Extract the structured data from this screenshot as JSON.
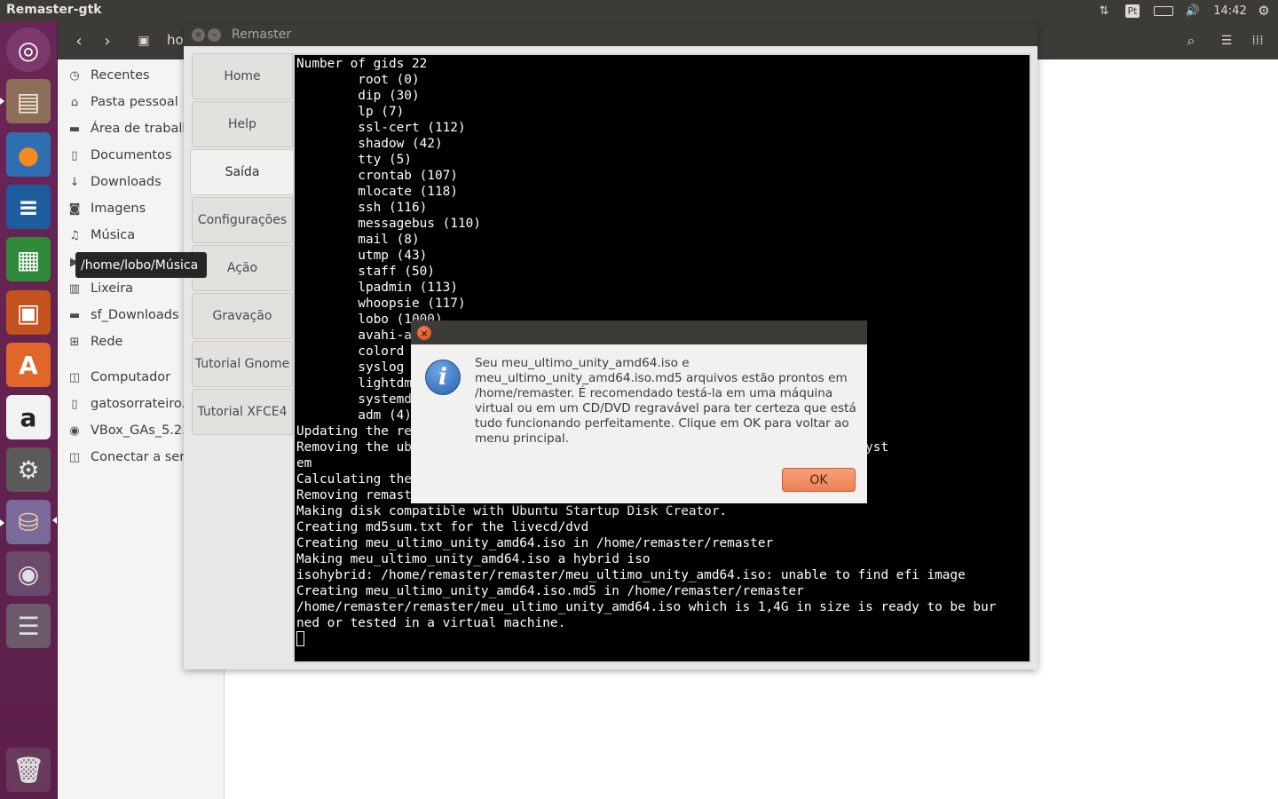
{
  "top_panel": {
    "app_title": "Remaster-gtk",
    "keyboard_layout": "Pt",
    "clock": "14:42"
  },
  "launcher": {
    "items": [
      {
        "name": "ubuntu-dash-icon",
        "glyph": "◎",
        "bg": "#7c3a6c",
        "fg": "#ffffff"
      },
      {
        "name": "files-icon",
        "glyph": "▤",
        "bg": "#8d6e59",
        "fg": "#f2e8dc"
      },
      {
        "name": "firefox-icon",
        "glyph": "●",
        "bg": "#2f6fb1",
        "fg": "#f58a1f"
      },
      {
        "name": "writer-icon",
        "glyph": "≡",
        "bg": "#1f5c9e",
        "fg": "#ffffff"
      },
      {
        "name": "calc-icon",
        "glyph": "▦",
        "bg": "#2f8a3a",
        "fg": "#ffffff"
      },
      {
        "name": "impress-icon",
        "glyph": "▣",
        "bg": "#c4521f",
        "fg": "#ffffff"
      },
      {
        "name": "software-center-icon",
        "glyph": "A",
        "bg": "#e0662a",
        "fg": "#ffffff"
      },
      {
        "name": "amazon-icon",
        "glyph": "a",
        "bg": "#f2f2f2",
        "fg": "#222222"
      },
      {
        "name": "system-settings-icon",
        "glyph": "⚙",
        "bg": "#5a5a5a",
        "fg": "#e8e8e8"
      },
      {
        "name": "remaster-icon",
        "glyph": "⛁",
        "bg": "#7a6a9a",
        "fg": "#f0d0a0"
      },
      {
        "name": "dvd-icon",
        "glyph": "◉",
        "bg": "#6a4a6a",
        "fg": "#e0e0e0"
      },
      {
        "name": "drives-icon",
        "glyph": "☰",
        "bg": "#6a5a6a",
        "fg": "#dcdcdc"
      },
      {
        "name": "trash-icon",
        "glyph": "🗑",
        "bg": "#6a3a5c",
        "fg": "#dcdcdc"
      }
    ]
  },
  "nautilus": {
    "path_fragment": "ho",
    "places": [
      {
        "name": "place-recentes",
        "icon": "clock-icon",
        "glyph": "◷",
        "label": "Recentes"
      },
      {
        "name": "place-pasta-pessoal",
        "icon": "home-icon",
        "glyph": "⌂",
        "label": "Pasta pessoal"
      },
      {
        "name": "place-area-de-trabalho",
        "icon": "desktop-folder-icon",
        "glyph": "▬",
        "label": "Área de trabalh"
      },
      {
        "name": "place-documentos",
        "icon": "document-icon",
        "glyph": "▯",
        "label": "Documentos"
      },
      {
        "name": "place-downloads",
        "icon": "download-icon",
        "glyph": "↓",
        "label": "Downloads"
      },
      {
        "name": "place-imagens",
        "icon": "camera-icon",
        "glyph": "◙",
        "label": "Imagens"
      },
      {
        "name": "place-musica",
        "icon": "music-icon",
        "glyph": "♫",
        "label": "Música"
      },
      {
        "name": "place-videos",
        "icon": "video-icon",
        "glyph": "▶",
        "label": ""
      },
      {
        "name": "place-lixeira",
        "icon": "trash-icon",
        "glyph": "▥",
        "label": "Lixeira"
      },
      {
        "name": "place-sf-downloads",
        "icon": "drive-icon",
        "glyph": "▬",
        "label": "sf_Downloads"
      },
      {
        "name": "place-rede",
        "icon": "network-icon",
        "glyph": "⊞",
        "label": "Rede"
      },
      {
        "name": "place-computador",
        "icon": "computer-icon",
        "glyph": "◫",
        "label": "Computador"
      },
      {
        "name": "place-gatosorrateiro",
        "icon": "drive-icon",
        "glyph": "▯",
        "label": "gatosorrateiro..."
      },
      {
        "name": "place-vbox-gas",
        "icon": "disc-icon",
        "glyph": "◉",
        "label": "VBox_GAs_5.2.2"
      },
      {
        "name": "place-conectar",
        "icon": "server-icon",
        "glyph": "◫",
        "label": "Conectar a servidor"
      }
    ],
    "tooltip": "/home/lobo/Música"
  },
  "remaster": {
    "title": "Remaster",
    "tabs": [
      "Home",
      "Help",
      "Saída",
      "Configurações",
      "Ação",
      "Gravação",
      "Tutorial Gnome",
      "Tutorial XFCE4"
    ],
    "active_tab": "Saída",
    "terminal_lines": [
      "Number of gids 22",
      "        root (0)",
      "        dip (30)",
      "        lp (7)",
      "        ssl-cert (112)",
      "        shadow (42)",
      "        tty (5)",
      "        crontab (107)",
      "        mlocate (118)",
      "        ssh (116)",
      "        messagebus (110)",
      "        mail (8)",
      "        utmp (43)",
      "        staff (50)",
      "        lpadmin (113)",
      "        whoopsie (117)",
      "        lobo (1000)",
      "        avahi-a",
      "        colord",
      "        syslog",
      "        lightdm",
      "        systemd",
      "        adm (4)",
      "Updating the re",
      "Removing the ub                                          d on the normal syst",
      "em",
      "Calculating the",
      "Removing remast",
      "Making disk compatible with Ubuntu Startup Disk Creator.",
      "Creating md5sum.txt for the livecd/dvd",
      "Creating meu_ultimo_unity_amd64.iso in /home/remaster/remaster",
      "Making meu_ultimo_unity_amd64.iso a hybrid iso",
      "isohybrid: /home/remaster/remaster/meu_ultimo_unity_amd64.iso: unable to find efi image",
      "Creating meu_ultimo_unity_amd64.iso.md5 in /home/remaster/remaster",
      "/home/remaster/remaster/meu_ultimo_unity_amd64.iso which is 1,4G in size is ready to be bur",
      "ned or tested in a virtual machine."
    ]
  },
  "dialog": {
    "message": "Seu meu_ultimo_unity_amd64.iso e meu_ultimo_unity_amd64.iso.md5 arquivos estão prontos em /home/remaster. É recomendado testá-la em uma máquina virtual ou em um CD/DVD regravável para ter certeza que está tudo funcionando perfeitamente. Clique em OK para voltar ao menu principal.",
    "ok_label": "OK",
    "close_glyph": "×",
    "info_glyph": "i"
  },
  "colors": {
    "panel": "#3c3b37",
    "launcher": "#5c1f4a",
    "accent_orange": "#ec7f52",
    "terminal_bg": "#000000"
  }
}
